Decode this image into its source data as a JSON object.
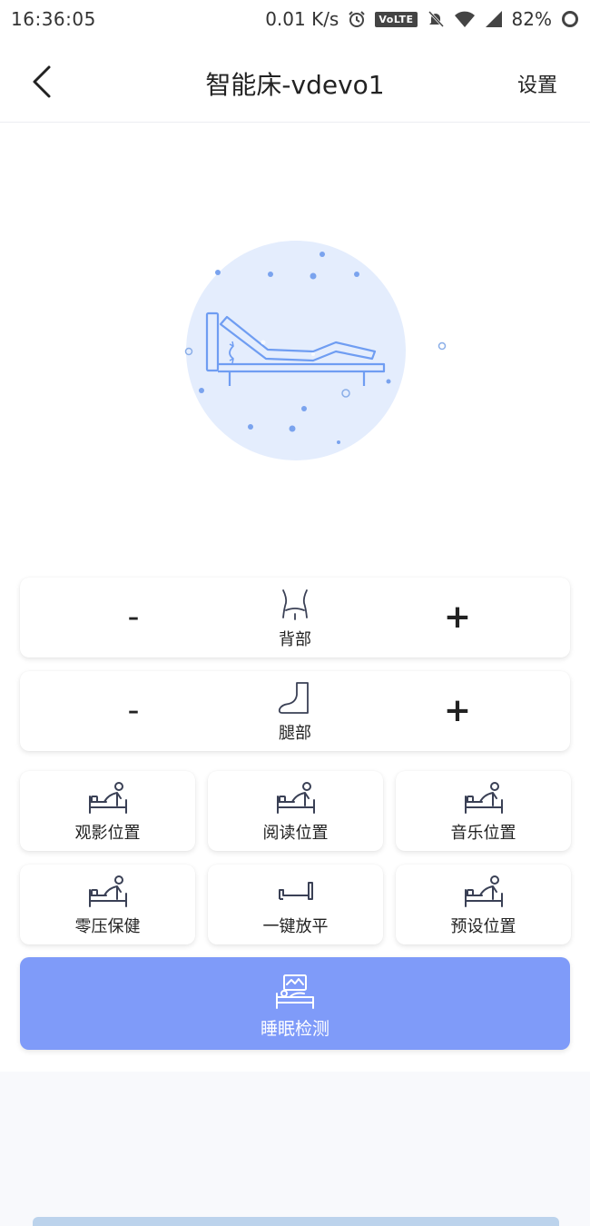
{
  "status_bar": {
    "time": "16:36:05",
    "net_speed": "0.01 K/s",
    "volte": "VoLTE",
    "battery": "82%"
  },
  "header": {
    "title": "智能床-vdevo1",
    "settings_label": "设置"
  },
  "adjust": [
    {
      "label": "背部",
      "minus": "-",
      "plus": "+",
      "icon": "back-body-icon"
    },
    {
      "label": "腿部",
      "minus": "-",
      "plus": "+",
      "icon": "foot-icon"
    }
  ],
  "positions": [
    {
      "label": "观影位置",
      "icon": "bed-person-icon"
    },
    {
      "label": "阅读位置",
      "icon": "bed-person-icon"
    },
    {
      "label": "音乐位置",
      "icon": "bed-person-icon"
    },
    {
      "label": "零压保健",
      "icon": "bed-person-icon"
    },
    {
      "label": "一键放平",
      "icon": "flat-bed-icon"
    },
    {
      "label": "预设位置",
      "icon": "bed-person-icon"
    }
  ],
  "sleep_detect": {
    "label": "睡眠检测",
    "icon": "sleep-monitor-icon"
  },
  "colors": {
    "accent": "#7f9bf9",
    "icon_stroke": "#3a4055",
    "bed_blue": "#6f9df2",
    "circle_bg": "#e4edfd"
  }
}
